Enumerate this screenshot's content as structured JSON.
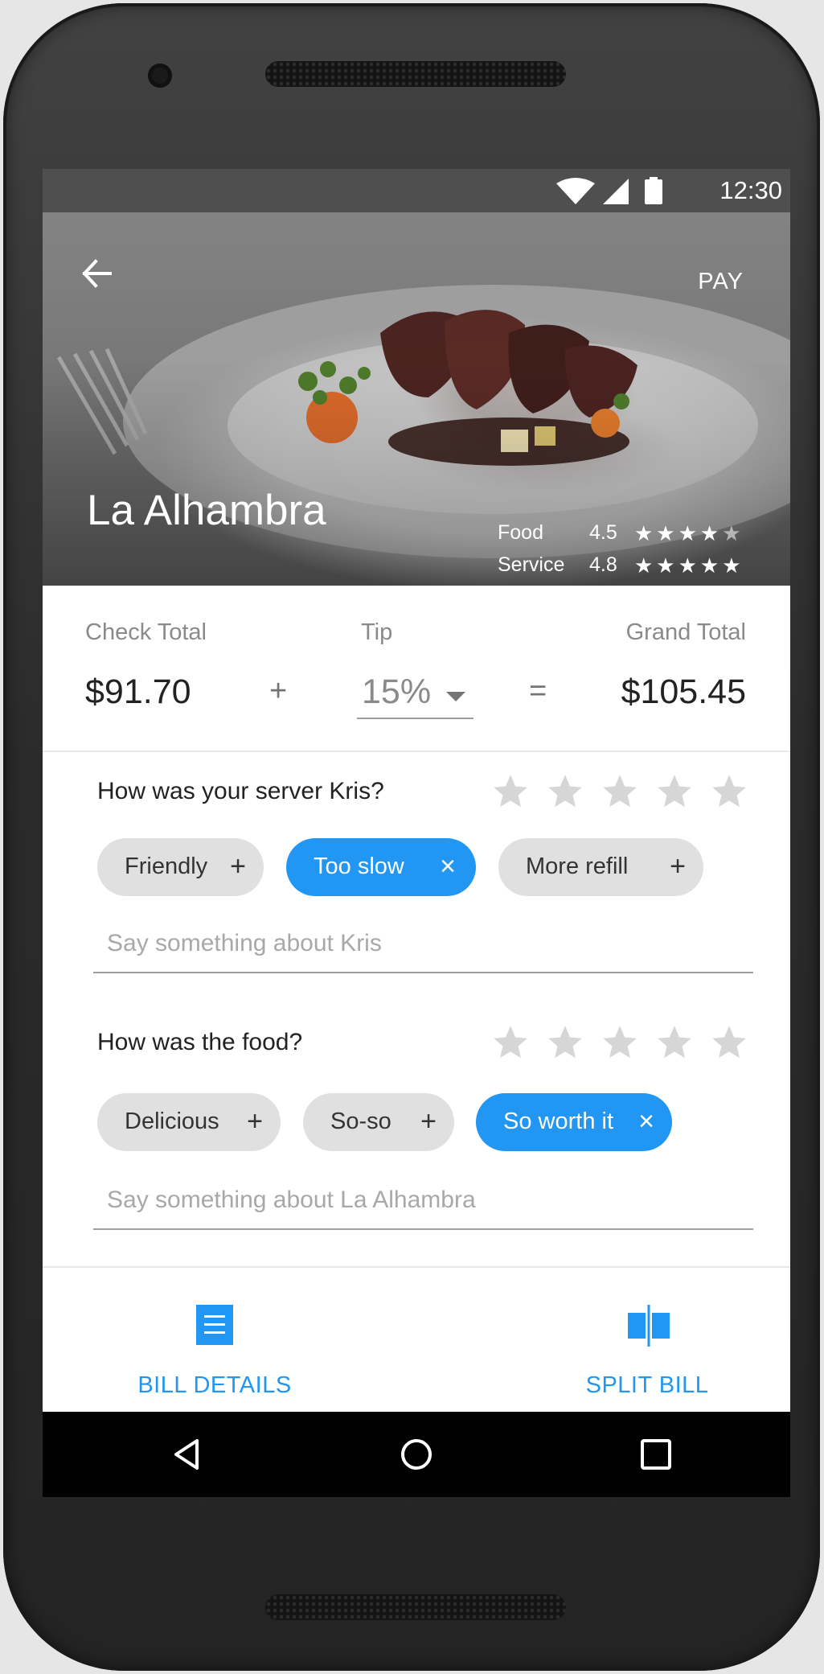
{
  "status_bar": {
    "time": "12:30",
    "icons": [
      "wifi-icon",
      "cell-signal-icon",
      "battery-icon"
    ]
  },
  "header": {
    "back_icon": "arrow-back-icon",
    "pay_label": "PAY",
    "restaurant_name": "La Alhambra",
    "ratings": [
      {
        "label": "Food",
        "value": "4.5",
        "stars": 4.5
      },
      {
        "label": "Service",
        "value": "4.8",
        "stars": 4.8
      }
    ]
  },
  "totals": {
    "check_total_label": "Check Total",
    "check_total_value": "$91.70",
    "plus": "+",
    "tip_label": "Tip",
    "tip_value": "15%",
    "equals": "=",
    "grand_total_label": "Grand Total",
    "grand_total_value": "$105.45"
  },
  "server_feedback": {
    "question": "How was your server Kris?",
    "rating": 0,
    "chips": [
      {
        "label": "Friendly",
        "icon": "+",
        "selected": false
      },
      {
        "label": "Too slow",
        "icon": "×",
        "selected": true
      },
      {
        "label": "More refill",
        "icon": "+",
        "selected": false
      }
    ],
    "comment_placeholder": "Say something about Kris"
  },
  "food_feedback": {
    "question": "How was the food?",
    "rating": 0,
    "chips": [
      {
        "label": "Delicious",
        "icon": "+",
        "selected": false
      },
      {
        "label": "So-so",
        "icon": "+",
        "selected": false
      },
      {
        "label": "So worth it",
        "icon": "×",
        "selected": true
      }
    ],
    "comment_placeholder": "Say something about La Alhambra"
  },
  "bottom_actions": [
    {
      "label": "BILL DETAILS",
      "icon": "receipt-list-icon"
    },
    {
      "label": "SPLIT BILL",
      "icon": "split-icon"
    }
  ],
  "nav_bar": {
    "buttons": [
      "back-triangle-icon",
      "home-circle-icon",
      "recents-square-icon"
    ]
  },
  "colors": {
    "accent": "#2196f3",
    "chip_default": "#e0e0e0",
    "star_inactive": "#d6d6d6"
  }
}
